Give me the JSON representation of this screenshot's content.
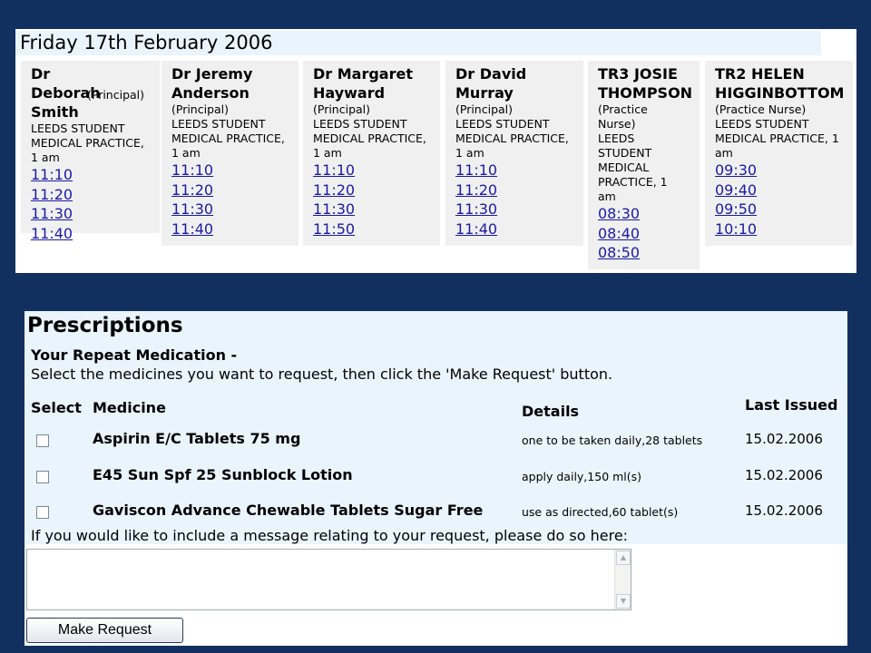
{
  "appointments": {
    "date": "Friday 17th February 2006",
    "clinicians": [
      {
        "name": "Dr Deborah Smith",
        "role": "(Principal)",
        "practice": "LEEDS STUDENT MEDICAL PRACTICE, 1 am",
        "slots": [
          "11:10",
          "11:20",
          "11:30",
          "11:40"
        ]
      },
      {
        "name": "Dr Jeremy Anderson",
        "role": "(Principal)",
        "practice": "LEEDS STUDENT MEDICAL PRACTICE, 1 am",
        "slots": [
          "11:10",
          "11:20",
          "11:30",
          "11:40"
        ]
      },
      {
        "name": "Dr Margaret Hayward",
        "role": "(Principal)",
        "practice": "LEEDS STUDENT MEDICAL PRACTICE, 1 am",
        "slots": [
          "11:10",
          "11:20",
          "11:30",
          "11:50"
        ]
      },
      {
        "name": "Dr David Murray",
        "role": "(Principal)",
        "practice": "LEEDS STUDENT MEDICAL PRACTICE, 1 am",
        "slots": [
          "11:10",
          "11:20",
          "11:30",
          "11:40"
        ]
      },
      {
        "name": "TR3 JOSIE THOMPSON",
        "role": "(Practice Nurse)",
        "practice": "LEEDS STUDENT MEDICAL PRACTICE, 1 am",
        "slots": [
          "08:30",
          "08:40",
          "08:50"
        ]
      },
      {
        "name": "TR2 HELEN HIGGINBOTTOM",
        "role": "(Practice Nurse)",
        "practice": "LEEDS STUDENT MEDICAL PRACTICE, 1 am",
        "slots": [
          "09:30",
          "09:40",
          "09:50",
          "10:10"
        ]
      }
    ]
  },
  "prescriptions": {
    "title": "Prescriptions",
    "subtitle": "Your Repeat Medication -",
    "instruction": "Select the medicines you want to request, then click the 'Make Request' button.",
    "headers": {
      "select": "Select",
      "medicine": "Medicine",
      "details": "Details",
      "last_issued": "Last Issued"
    },
    "items": [
      {
        "medicine": "Aspirin E/C Tablets 75 mg",
        "details": "one to be taken daily,28 tablets",
        "last_issued": "15.02.2006",
        "checked": false
      },
      {
        "medicine": "E45 Sun Spf 25 Sunblock Lotion",
        "details": "apply daily,150 ml(s)",
        "last_issued": "15.02.2006",
        "checked": false
      },
      {
        "medicine": "Gaviscon Advance Chewable Tablets Sugar Free",
        "details": "use as directed,60 tablet(s)",
        "last_issued": "15.02.2006",
        "checked": false
      }
    ],
    "message_label": "If you would like to include a message relating to your request, please do so here:",
    "message_value": "",
    "submit_label": "Make Request"
  }
}
